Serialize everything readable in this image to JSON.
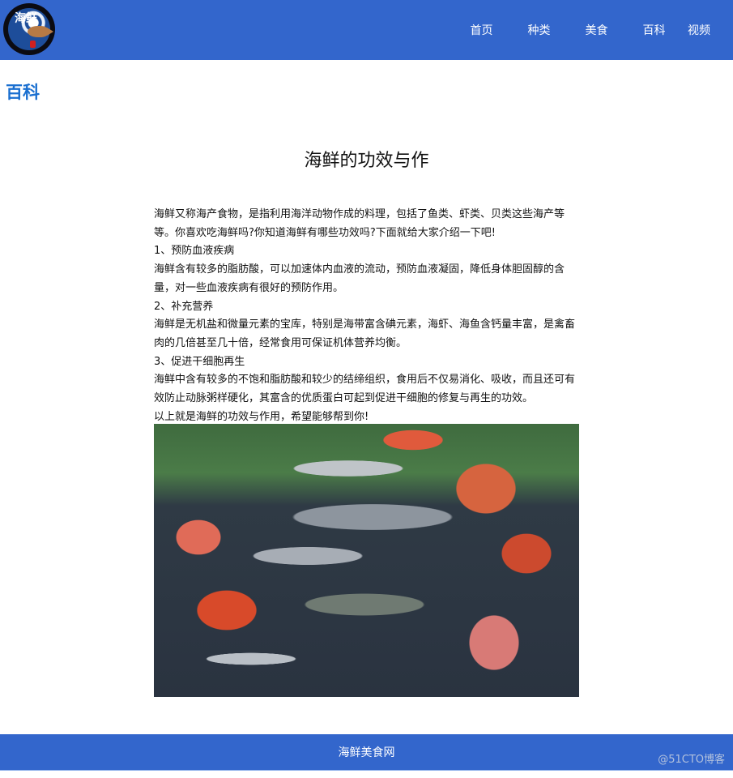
{
  "header": {
    "logo": {
      "label": "海鲜",
      "icon": "seafood-logo-icon"
    },
    "nav": [
      {
        "label": "首页"
      },
      {
        "label": "种类"
      },
      {
        "label": "美食"
      },
      {
        "label": "百科"
      },
      {
        "label": "视频"
      }
    ],
    "background_color": "#3366cc"
  },
  "section": {
    "title": "百科",
    "title_color": "#1a6fd0"
  },
  "article": {
    "title": "海鲜的功效与作",
    "paragraphs": [
      "海鲜又称海产食物，是指利用海洋动物作成的料理，包括了鱼类、虾类、贝类这些海产等等。你喜欢吃海鲜吗?你知道海鲜有哪些功效吗?下面就给大家介绍一下吧!",
      "1、预防血液疾病",
      "海鲜含有较多的脂肪酸，可以加速体内血液的流动，预防血液凝固，降低身体胆固醇的含量，对一些血液疾病有很好的预防作用。",
      "2、补充营养",
      "海鲜是无机盐和微量元素的宝库，特别是海带富含碘元素，海虾、海鱼含钙量丰富，是禽畜肉的几倍甚至几十倍，经常食用可保证机体营养均衡。",
      "3、促进干细胞再生",
      "海鲜中含有较多的不饱和脂肪酸和较少的结缔组织，食用后不仅易消化、吸收，而且还可有效防止动脉粥样硬化，其富含的优质蛋白可起到促进干细胞的修复与再生的功效。",
      "以上就是海鲜的功效与作用，希望能够帮到你!"
    ],
    "image": {
      "alt": "海鲜"
    }
  },
  "footer": {
    "text": "海鲜美食网",
    "background_color": "#3366cc"
  },
  "watermark": {
    "text": "@51CTO博客"
  }
}
